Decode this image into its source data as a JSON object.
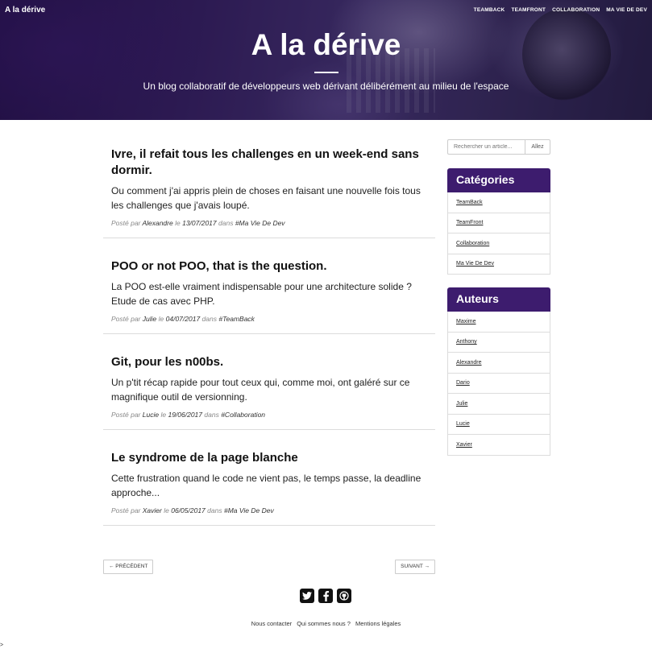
{
  "header": {
    "brand": "A la dérive",
    "nav": [
      "TEAMBACK",
      "TEAMFRONT",
      "COLLABORATION",
      "MA VIE DE DEV"
    ],
    "title": "A la dérive",
    "subtitle": "Un blog collaboratif de développeurs web dérivant délibérément au milieu de l'espace"
  },
  "posts": [
    {
      "title": "Ivre, il refait tous les challenges en un week-end sans dormir.",
      "excerpt": "Ou comment j'ai appris plein de choses en faisant une nouvelle fois tous les challenges que j'avais loupé.",
      "meta_by": "Posté par",
      "author": "Alexandre",
      "meta_on": "le",
      "date": "13/07/2017",
      "meta_in": "dans",
      "tag": "#Ma Vie De Dev"
    },
    {
      "title": "POO or not POO, that is the question.",
      "excerpt": "La POO est-elle vraiment indispensable pour une architecture solide ? Etude de cas avec PHP.",
      "meta_by": "Posté par",
      "author": "Julie",
      "meta_on": "le",
      "date": "04/07/2017",
      "meta_in": "dans",
      "tag": "#TeamBack"
    },
    {
      "title": "Git, pour les n00bs.",
      "excerpt": "Un p'tit récap rapide pour tout ceux qui, comme moi, ont galéré sur ce magnifique outil de versionning.",
      "meta_by": "Posté par",
      "author": "Lucie",
      "meta_on": "le",
      "date": "19/06/2017",
      "meta_in": "dans",
      "tag": "#Collaboration"
    },
    {
      "title": "Le syndrome de la page blanche",
      "excerpt": "Cette frustration quand le code ne vient pas, le temps passe, la deadline approche...",
      "meta_by": "Posté par",
      "author": "Xavier",
      "meta_on": "le",
      "date": "06/05/2017",
      "meta_in": "dans",
      "tag": "#Ma Vie De Dev"
    }
  ],
  "pager": {
    "prev": "← PRÉCÉDENT",
    "next": "SUIVANT →"
  },
  "search": {
    "placeholder": "Rechercher un article...",
    "button": "Allez"
  },
  "categories": {
    "title": "Catégories",
    "items": [
      "TeamBack",
      "TeamFront",
      "Collaboration",
      "Ma Vie De Dev"
    ]
  },
  "authors": {
    "title": "Auteurs",
    "items": [
      "Maxime",
      "Anthony",
      "Alexandre",
      "Dario",
      "Julie",
      "Lucie",
      "Xavier"
    ]
  },
  "footer": {
    "social": [
      "twitter-icon",
      "facebook-icon",
      "github-icon"
    ],
    "links": [
      "Nous contacter",
      "Qui sommes nous ?",
      "Mentions légales"
    ],
    "corner": ">"
  },
  "colors": {
    "accent": "#3d1c6e",
    "header_bg": "#2a1452"
  }
}
